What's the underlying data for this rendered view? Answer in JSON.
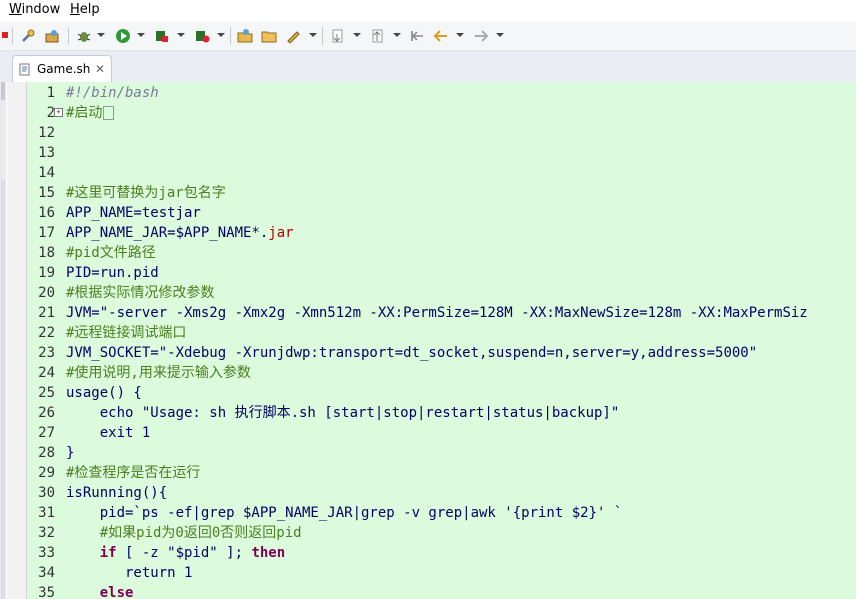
{
  "menu": {
    "window": "Window",
    "window_mnemonic": "W",
    "window_rest": "indow",
    "help": "Help",
    "help_mnemonic": "H",
    "help_rest": "elp"
  },
  "toolbar": {
    "icons": [
      "wrench-icon",
      "bug-icon",
      "run-icon",
      "coverage-icon",
      "external-tools-icon",
      "open-folder-icon",
      "open-file-icon",
      "pen-icon",
      "next-annotation-icon",
      "prev-annotation-icon",
      "last-edit-icon",
      "back-icon",
      "forward-icon"
    ]
  },
  "tab": {
    "label": "Game.sh",
    "close": "✕"
  },
  "editor": {
    "lines": [
      {
        "n": "1",
        "segs": [
          {
            "c": "t-shebang",
            "t": "#!/bin/bash"
          }
        ]
      },
      {
        "n": "2",
        "fold": true,
        "segs": [
          {
            "c": "t-comment",
            "t": "#启动"
          }
        ],
        "collapsed": true
      },
      {
        "n": "12",
        "segs": []
      },
      {
        "n": "13",
        "segs": []
      },
      {
        "n": "14",
        "segs": []
      },
      {
        "n": "15",
        "segs": [
          {
            "c": "t-comment",
            "t": "#这里可替换为jar包名字"
          }
        ]
      },
      {
        "n": "16",
        "segs": [
          {
            "c": "",
            "t": "APP_NAME=testjar"
          }
        ]
      },
      {
        "n": "17",
        "segs": [
          {
            "c": "",
            "t": "APP_NAME_JAR=$APP_NAME*."
          },
          {
            "c": "t-red",
            "t": "jar"
          }
        ]
      },
      {
        "n": "18",
        "segs": [
          {
            "c": "t-comment",
            "t": "#pid文件路径"
          }
        ]
      },
      {
        "n": "19",
        "segs": [
          {
            "c": "",
            "t": "PID=run.pid"
          }
        ]
      },
      {
        "n": "20",
        "segs": [
          {
            "c": "t-comment",
            "t": "#根据实际情况修改参数"
          }
        ]
      },
      {
        "n": "21",
        "segs": [
          {
            "c": "",
            "t": "JVM=\"-server -Xms2g -Xmx2g -Xmn512m -XX:PermSize=128M -XX:MaxNewSize=128m -XX:MaxPermSiz"
          }
        ]
      },
      {
        "n": "22",
        "segs": [
          {
            "c": "t-comment",
            "t": "#远程链接调试端口"
          }
        ]
      },
      {
        "n": "23",
        "segs": [
          {
            "c": "",
            "t": "JVM_SOCKET=\"-Xdebug -Xrunjdwp:transport=dt_socket,suspend=n,server=y,address=5000\""
          }
        ]
      },
      {
        "n": "24",
        "segs": [
          {
            "c": "t-comment",
            "t": "#使用说明,用来提示输入参数"
          }
        ]
      },
      {
        "n": "25",
        "segs": [
          {
            "c": "",
            "t": "usage() {"
          }
        ]
      },
      {
        "n": "26",
        "segs": [
          {
            "c": "",
            "t": "    echo \"Usage: sh 执行脚本.sh [start|stop|restart|status|backup]\""
          }
        ]
      },
      {
        "n": "27",
        "segs": [
          {
            "c": "",
            "t": "    exit 1"
          }
        ]
      },
      {
        "n": "28",
        "segs": [
          {
            "c": "",
            "t": "}"
          }
        ]
      },
      {
        "n": "29",
        "segs": [
          {
            "c": "t-comment",
            "t": "#检查程序是否在运行"
          }
        ]
      },
      {
        "n": "30",
        "segs": [
          {
            "c": "",
            "t": "isRunning(){"
          }
        ]
      },
      {
        "n": "31",
        "segs": [
          {
            "c": "",
            "t": "    pid=`ps -ef|grep $APP_NAME_JAR|grep -v grep|awk '{print $2}' `"
          }
        ]
      },
      {
        "n": "32",
        "segs": [
          {
            "c": "t-comment",
            "t": "    #如果pid为0返回0否则返回pid"
          }
        ]
      },
      {
        "n": "33",
        "segs": [
          {
            "c": "t-kw",
            "t": "    if"
          },
          {
            "c": "",
            "t": " [ -z \"$pid\" ]; "
          },
          {
            "c": "t-kw",
            "t": "then"
          }
        ]
      },
      {
        "n": "34",
        "segs": [
          {
            "c": "",
            "t": "       return 1"
          }
        ]
      },
      {
        "n": "35",
        "segs": [
          {
            "c": "t-kw",
            "t": "    else"
          }
        ]
      }
    ]
  }
}
